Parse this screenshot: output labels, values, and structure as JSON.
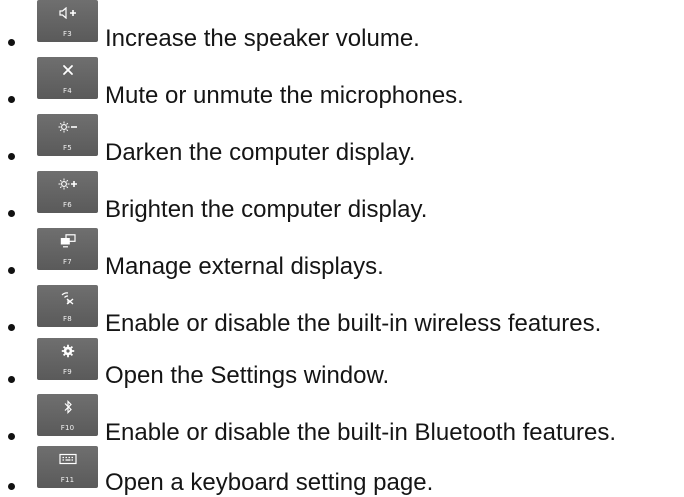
{
  "items": [
    {
      "key": "F3",
      "icon": "speaker-volume-up-icon",
      "text": "Increase the speaker volume."
    },
    {
      "key": "F4",
      "icon": "microphone-mute-icon",
      "text": "Mute or unmute the microphones."
    },
    {
      "key": "F5",
      "icon": "brightness-down-icon",
      "text": "Darken the computer display."
    },
    {
      "key": "F6",
      "icon": "brightness-up-icon",
      "text": "Brighten the computer display."
    },
    {
      "key": "F7",
      "icon": "external-display-icon",
      "text": "Manage external displays."
    },
    {
      "key": "F8",
      "icon": "wireless-toggle-icon",
      "text": "Enable or disable the built-in wireless features."
    },
    {
      "key": "F9",
      "icon": "settings-gear-icon",
      "text": "Open the Settings window."
    },
    {
      "key": "F10",
      "icon": "bluetooth-icon",
      "text": "Enable or disable the built-in Bluetooth features."
    },
    {
      "key": "F11",
      "icon": "keyboard-icon",
      "text": "Open a keyboard setting page."
    }
  ]
}
